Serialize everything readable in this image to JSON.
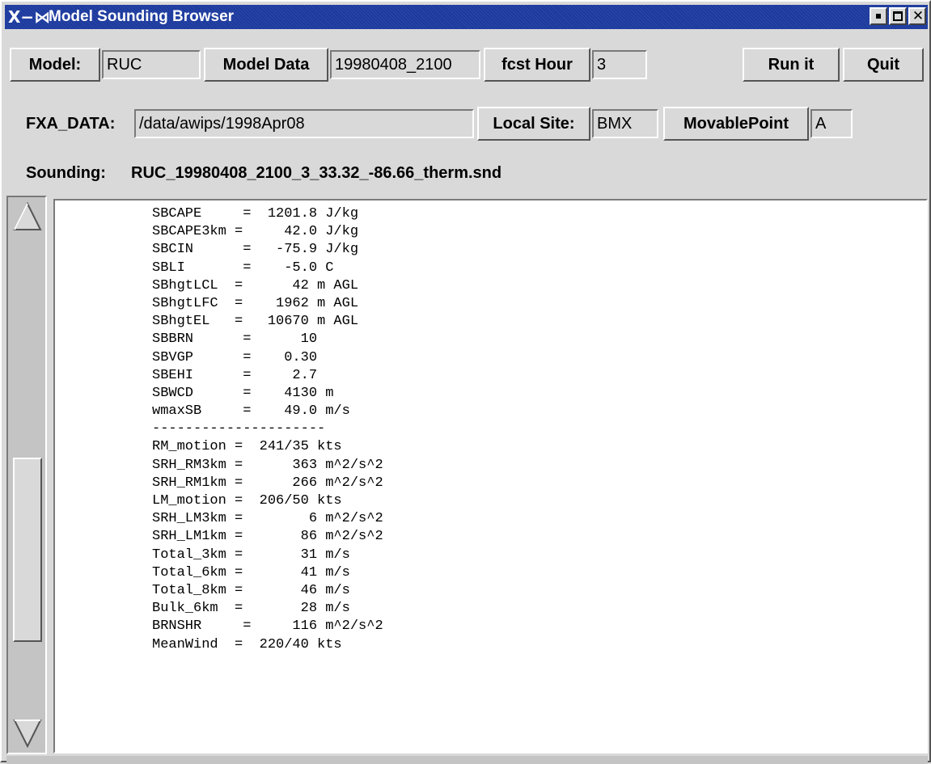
{
  "window": {
    "title": "Model Sounding Browser"
  },
  "controls": {
    "model_label": "Model:",
    "model_value": "RUC",
    "model_data_label": "Model Data",
    "model_data_value": "19980408_2100",
    "fcst_hour_label": "fcst Hour",
    "fcst_hour_value": "3",
    "run_label": "Run it",
    "quit_label": "Quit",
    "fxa_data_label": "FXA_DATA:",
    "fxa_data_value": "/data/awips/1998Apr08",
    "local_site_label": "Local Site:",
    "local_site_value": "BMX",
    "movable_point_label": "MovablePoint",
    "movable_point_value": "A",
    "sounding_label": "Sounding:",
    "sounding_file": "RUC_19980408_2100_3_33.32_-86.66_therm.snd"
  },
  "output_lines": [
    "SBCAPE     =  1201.8 J/kg",
    "SBCAPE3km =     42.0 J/kg",
    "SBCIN      =   -75.9 J/kg",
    "SBLI       =    -5.0 C",
    "SBhgtLCL  =      42 m AGL",
    "SBhgtLFC  =    1962 m AGL",
    "SBhgtEL   =   10670 m AGL",
    "SBBRN      =      10",
    "SBVGP      =    0.30",
    "SBEHI      =     2.7",
    "SBWCD      =    4130 m",
    "wmaxSB     =    49.0 m/s",
    "---------------------",
    "RM_motion =  241/35 kts",
    "SRH_RM3km =      363 m^2/s^2",
    "SRH_RM1km =      266 m^2/s^2",
    "LM_motion =  206/50 kts",
    "SRH_LM3km =        6 m^2/s^2",
    "SRH_LM1km =       86 m^2/s^2",
    "Total_3km =       31 m/s",
    "Total_6km =       41 m/s",
    "Total_8km =       46 m/s",
    "Bulk_6km  =       28 m/s",
    "BRNSHR     =     116 m^2/s^2",
    "MeanWind  =  220/40 kts"
  ],
  "icons": {
    "window_icon": "x-window-icon",
    "minimize": "minimize-icon",
    "maximize": "maximize-icon",
    "close": "close-icon",
    "scroll_up": "scroll-up-arrow-icon",
    "scroll_down": "scroll-down-arrow-icon"
  },
  "colors": {
    "titlebar": "#1c3a9e",
    "background": "#d9d9d9",
    "text_area": "#ffffff"
  }
}
